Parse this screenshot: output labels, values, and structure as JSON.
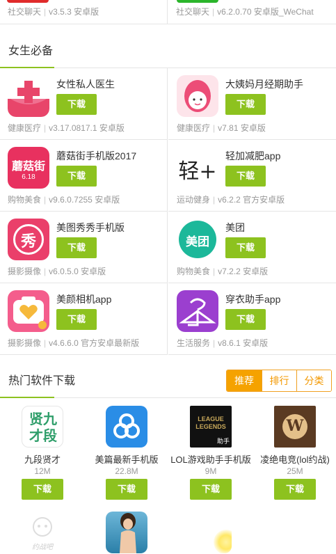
{
  "top_row": [
    {
      "category": "社交聊天",
      "meta": "v3.5.3 安卓版"
    },
    {
      "category": "社交聊天",
      "meta": "v6.2.0.70 安卓版_WeChat"
    }
  ],
  "section_female": {
    "title": "女生必备",
    "download_label": "下载",
    "apps": [
      {
        "name": "女性私人医生",
        "category": "健康医疗",
        "meta": "v3.17.0817.1 安卓版",
        "icon": "medical-cross-icon"
      },
      {
        "name": "大姨妈月经期助手",
        "category": "健康医疗",
        "meta": "v7.81 安卓版",
        "icon": "girl-face-icon"
      },
      {
        "name": "蘑菇街手机版2017",
        "category": "购物美食",
        "meta": "v9.6.0.7255 安卓版",
        "icon": "mogujie-icon",
        "icon_text": "蘑菇街",
        "icon_sub": "6.18"
      },
      {
        "name": "轻加减肥app",
        "category": "运动健身",
        "meta": "v6.2.2 官方安卓版",
        "icon": "qingjia-icon",
        "icon_text": "轻+"
      },
      {
        "name": "美图秀秀手机版",
        "category": "摄影摄像",
        "meta": "v6.0.5.0 安卓版",
        "icon": "meitu-icon",
        "icon_text": "秀"
      },
      {
        "name": "美团",
        "category": "购物美食",
        "meta": "v7.2.2 安卓版",
        "icon": "meituan-icon",
        "icon_text": "美团"
      },
      {
        "name": "美颜相机app",
        "category": "摄影摄像",
        "meta": "v4.6.6.0 官方安卓最新版",
        "icon": "beauty-camera-icon"
      },
      {
        "name": "穿衣助手app",
        "category": "生活服务",
        "meta": "v8.6.1 安卓版",
        "icon": "hanger-icon"
      }
    ]
  },
  "section_hot": {
    "title": "热门软件下载",
    "tabs": [
      "推荐",
      "排行",
      "分类"
    ],
    "download_label": "下载",
    "apps": [
      {
        "name": "九段贤才",
        "size": "12M",
        "icon": "jiuduan-icon",
        "icon_text": "贤九才段"
      },
      {
        "name": "美篇最新手机版",
        "size": "22.8M",
        "icon": "meipian-icon"
      },
      {
        "name": "LOL游戏助手手机版",
        "size": "9M",
        "icon": "lol-icon",
        "icon_text": "LEAGUE LEGENDS",
        "icon_sub": "助手"
      },
      {
        "name": "凌绝电竞(lol约战)",
        "size": "25M",
        "icon": "lingjue-icon",
        "icon_text": "W"
      }
    ],
    "partial_row": [
      {
        "icon": "yuezhan-icon",
        "icon_text": "约战吧"
      },
      {
        "icon": "photo-girl-icon"
      },
      {
        "icon": "yellow-blur-icon"
      }
    ]
  },
  "colors": {
    "accent_green": "#8dc21f",
    "tab_orange": "#f5a200"
  }
}
